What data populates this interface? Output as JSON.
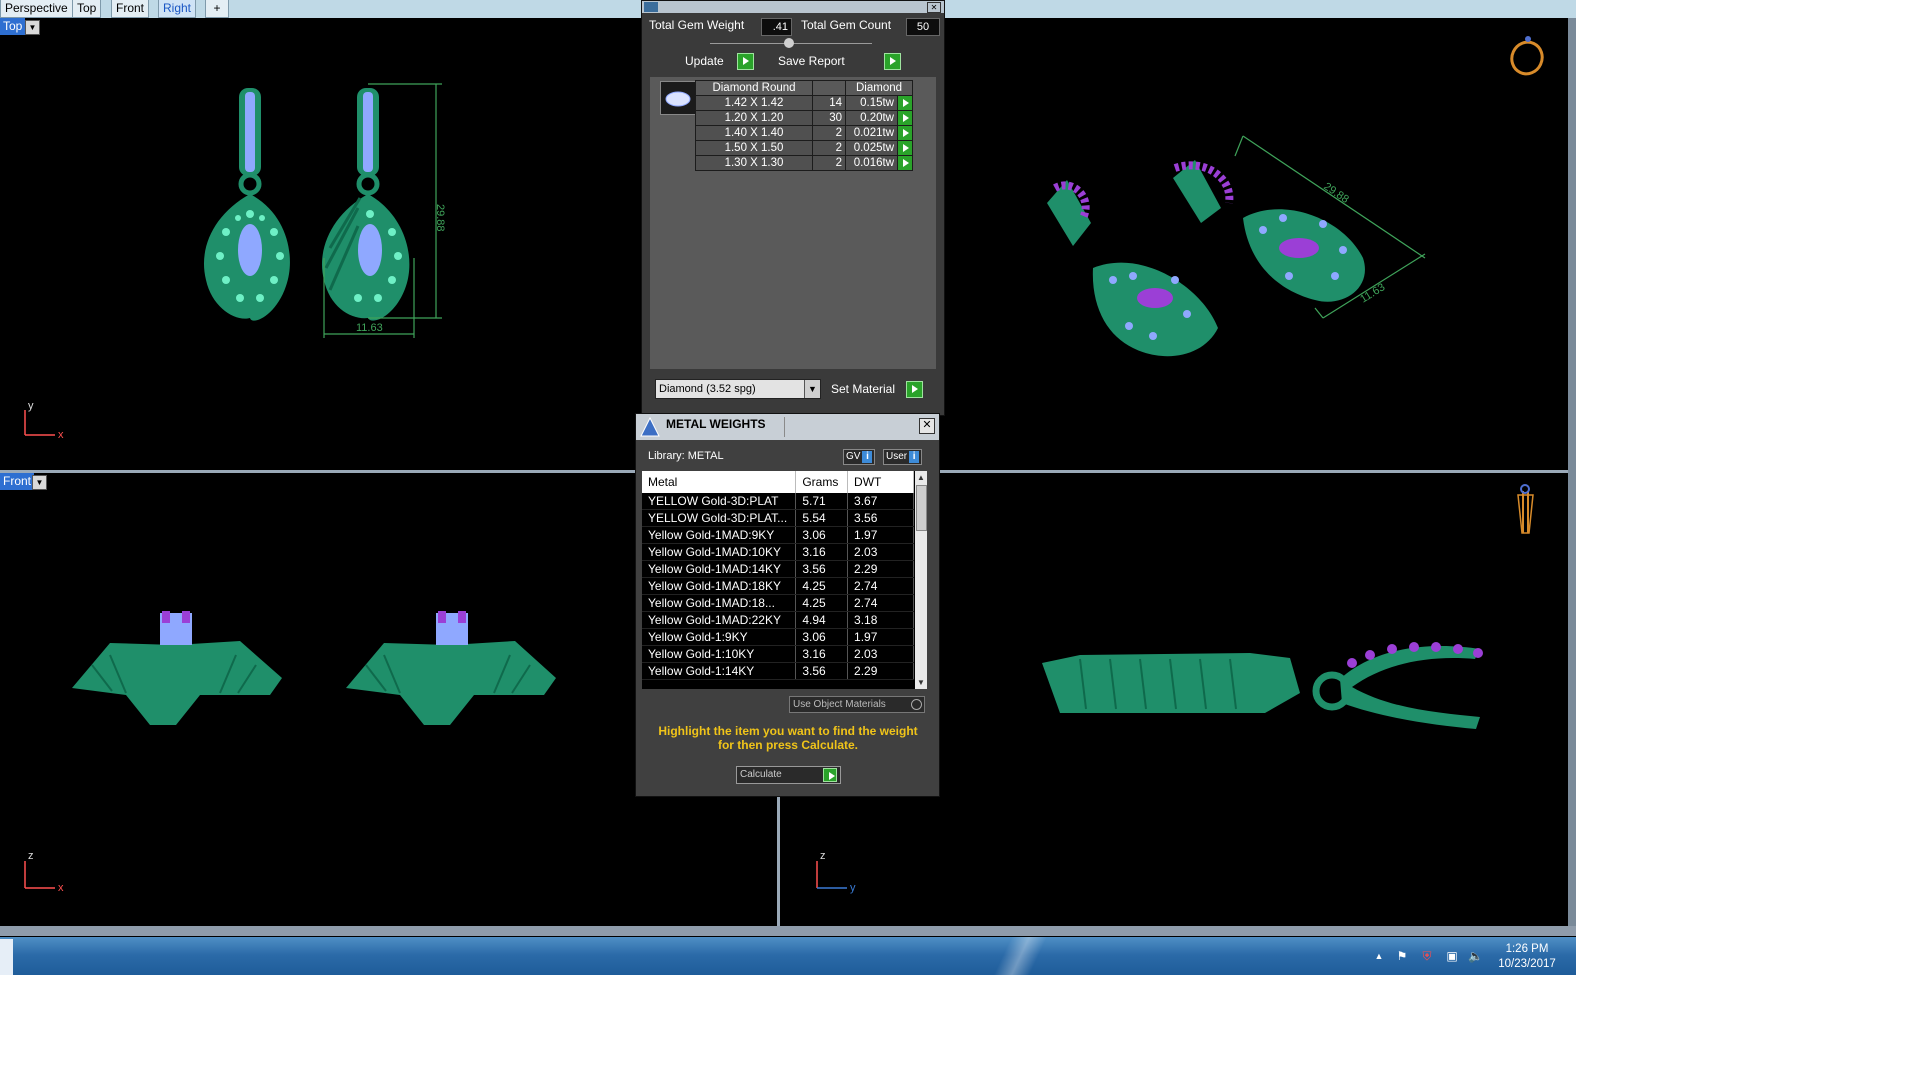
{
  "tabs": [
    {
      "label": "Perspective",
      "active": false
    },
    {
      "label": "Top",
      "active": false
    },
    {
      "label": "Front",
      "active": false
    },
    {
      "label": "Right",
      "active": true
    }
  ],
  "add_tab_glyph": "+",
  "viewports": {
    "top_label": "Top",
    "front_label": "Front",
    "dim_height": "29.88",
    "dim_width": "11.63",
    "persp_dim_a": "29.88",
    "persp_dim_b": "11.63"
  },
  "axes": {
    "top": {
      "v": "y",
      "h": "x"
    },
    "front": {
      "v": "z",
      "h": "x"
    },
    "right": {
      "v": "z",
      "h": "y"
    }
  },
  "gem_panel": {
    "total_weight_label": "Total Gem Weight",
    "total_weight_value": ".41",
    "total_count_label": "Total Gem Count",
    "total_count_value": "50",
    "update_label": "Update",
    "save_report_label": "Save Report",
    "headers": [
      "Diamond Round",
      "",
      "Diamond"
    ],
    "rows": [
      {
        "size": "1.42 X 1.42",
        "count": "14",
        "weight": "0.15tw"
      },
      {
        "size": "1.20 X 1.20",
        "count": "30",
        "weight": "0.20tw"
      },
      {
        "size": "1.40 X 1.40",
        "count": "2",
        "weight": "0.021tw"
      },
      {
        "size": "1.50 X 1.50",
        "count": "2",
        "weight": "0.025tw"
      },
      {
        "size": "1.30 X 1.30",
        "count": "2",
        "weight": "0.016tw"
      }
    ],
    "material_value": "Diamond      (3.52 spg)",
    "set_material_label": "Set Material"
  },
  "metal_panel": {
    "title": "METAL WEIGHTS",
    "library": "Library: METAL",
    "gv_label": "GV",
    "user_label": "User",
    "columns": [
      "Metal",
      "Grams",
      "DWT"
    ],
    "rows": [
      {
        "metal": "YELLOW Gold-3D:PLAT",
        "grams": "5.71",
        "dwt": "3.67"
      },
      {
        "metal": "YELLOW Gold-3D:PLAT...",
        "grams": "5.54",
        "dwt": "3.56"
      },
      {
        "metal": "Yellow Gold-1MAD:9KY",
        "grams": "3.06",
        "dwt": "1.97"
      },
      {
        "metal": "Yellow Gold-1MAD:10KY",
        "grams": "3.16",
        "dwt": "2.03"
      },
      {
        "metal": "Yellow Gold-1MAD:14KY",
        "grams": "3.56",
        "dwt": "2.29"
      },
      {
        "metal": "Yellow Gold-1MAD:18KY",
        "grams": "4.25",
        "dwt": "2.74"
      },
      {
        "metal": "Yellow Gold-1MAD:18...",
        "grams": "4.25",
        "dwt": "2.74"
      },
      {
        "metal": "Yellow Gold-1MAD:22KY",
        "grams": "4.94",
        "dwt": "3.18"
      },
      {
        "metal": "Yellow Gold-1:9KY",
        "grams": "3.06",
        "dwt": "1.97"
      },
      {
        "metal": "Yellow Gold-1:10KY",
        "grams": "3.16",
        "dwt": "2.03"
      },
      {
        "metal": "Yellow Gold-1:14KY",
        "grams": "3.56",
        "dwt": "2.29"
      }
    ],
    "use_object_materials": "Use Object Materials",
    "hint_line1": "Highlight the item you want to find the weight",
    "hint_line2": "for then press Calculate.",
    "calculate_label": "Calculate"
  },
  "taskbar": {
    "time": "1:26 PM",
    "date": "10/23/2017"
  },
  "colors": {
    "model_green": "#1f8f6a",
    "gem_blue": "#8fa8ff",
    "gem_purple": "#9b3fd6",
    "dimension_green": "#3fa35a",
    "hint_yellow": "#f0c419"
  }
}
